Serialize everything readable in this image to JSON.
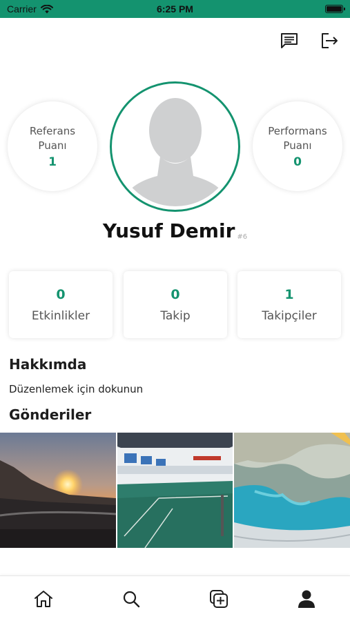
{
  "status_bar": {
    "carrier": "Carrier",
    "time": "6:25 PM"
  },
  "top_bar": {
    "icons": [
      "message-icon",
      "logout-icon"
    ]
  },
  "profile": {
    "reference_score": {
      "label": "Referans Puanı",
      "value": "1"
    },
    "performance_score": {
      "label": "Performans Puanı",
      "value": "0"
    },
    "name": "Yusuf Demir",
    "user_id": "#6"
  },
  "stats": [
    {
      "value": "0",
      "label": "Etkinlikler"
    },
    {
      "value": "0",
      "label": "Takip"
    },
    {
      "value": "1",
      "label": "Takipçiler"
    }
  ],
  "about": {
    "title": "Hakkımda",
    "text": "Düzenlemek için dokunun"
  },
  "posts": {
    "title": "Gönderiler"
  },
  "tab_bar": {
    "items": [
      "home-icon",
      "search-icon",
      "add-post-icon",
      "profile-icon"
    ]
  },
  "colors": {
    "accent": "#14936f",
    "status_bar": "#14936f"
  }
}
